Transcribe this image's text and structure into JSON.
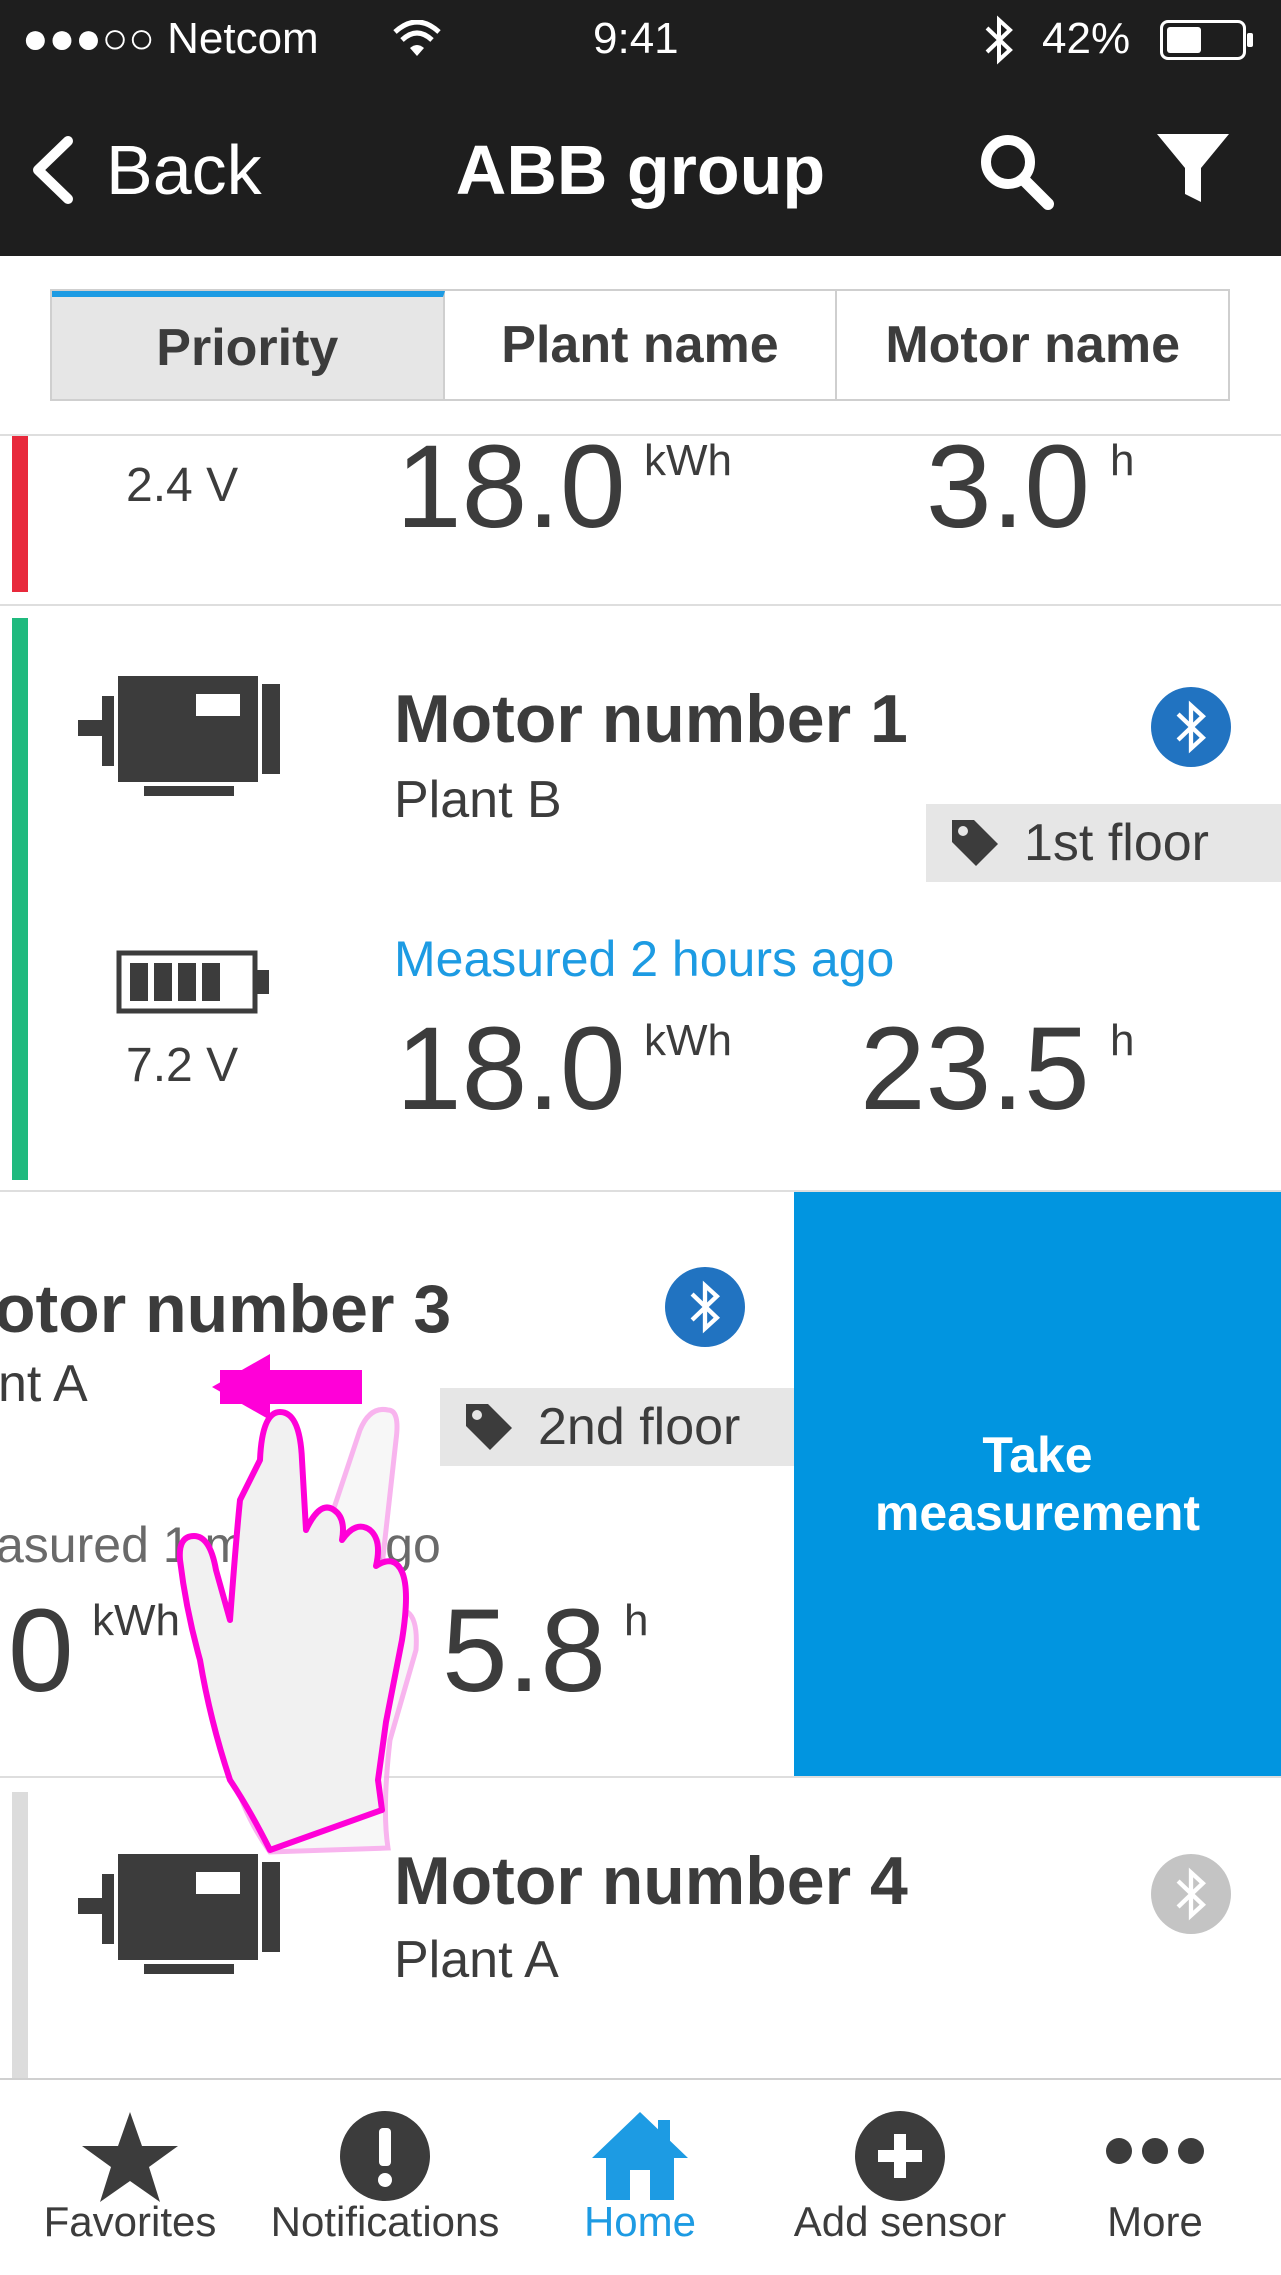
{
  "status": {
    "carrier": "●●●○○ Netcom",
    "time": "9:41",
    "battery": "42%"
  },
  "nav": {
    "back_label": "Back",
    "title": "ABB group"
  },
  "segments": [
    "Priority",
    "Plant name",
    "Motor name"
  ],
  "cards": [
    {
      "voltage": "2.4 V",
      "energy": "18.0",
      "energy_unit": "kWh",
      "hours": "3.0",
      "hours_unit": "h",
      "status_color": "#e8293c"
    },
    {
      "title": "Motor number 1",
      "plant": "Plant B",
      "tag": "1st floor",
      "measured": "Measured 2 hours ago",
      "voltage": "7.2 V",
      "energy": "18.0",
      "energy_unit": "kWh",
      "hours": "23.5",
      "hours_unit": "h",
      "status_color": "#1fba7e"
    },
    {
      "title": "otor number 3",
      "plant": "nt A",
      "tag": "2nd floor",
      "measured": "asured 1 month ago",
      "energy": "0",
      "energy_unit": "kWh",
      "hours": "5.8",
      "hours_unit": "h",
      "action": "Take measurement"
    },
    {
      "title": "Motor number 4",
      "plant": "Plant A",
      "status_color": "#dcdcdc"
    }
  ],
  "tabs": [
    "Favorites",
    "Notifications",
    "Home",
    "Add sensor",
    "More"
  ],
  "colors": {
    "accent": "#1d9be3",
    "action_bg": "#0195e0",
    "bluetooth": "#2173c1",
    "gesture": "#ff00d8"
  }
}
